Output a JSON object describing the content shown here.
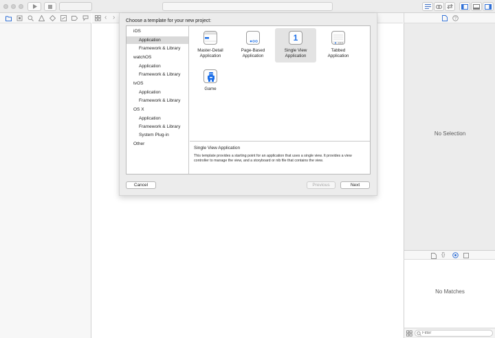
{
  "dialog": {
    "title": "Choose a template for your new project:",
    "categories": [
      {
        "label": "iOS",
        "items": [
          "Application",
          "Framework & Library"
        ]
      },
      {
        "label": "watchOS",
        "items": [
          "Application",
          "Framework & Library"
        ]
      },
      {
        "label": "tvOS",
        "items": [
          "Application",
          "Framework & Library"
        ]
      },
      {
        "label": "OS X",
        "items": [
          "Application",
          "Framework & Library",
          "System Plug-in"
        ]
      },
      {
        "label": "Other",
        "items": []
      }
    ],
    "selected_category": "iOS / Application",
    "templates": [
      {
        "label": "Master-Detail\nApplication",
        "icon": "master-detail-icon"
      },
      {
        "label": "Page-Based\nApplication",
        "icon": "page-based-icon"
      },
      {
        "label": "Single View\nApplication",
        "icon": "single-view-icon",
        "glyph": "1"
      },
      {
        "label": "Tabbed\nApplication",
        "icon": "tabbed-icon"
      },
      {
        "label": "Game",
        "icon": "game-icon"
      }
    ],
    "selected_template": "Single View Application",
    "description": {
      "title": "Single View Application",
      "text": "This template provides a starting point for an application that uses a single view. It provides a view controller to manage the view, and a storyboard or nib file that contains the view."
    },
    "buttons": {
      "cancel": "Cancel",
      "previous": "Previous",
      "next": "Next"
    }
  },
  "inspector": {
    "no_selection": "No Selection"
  },
  "library": {
    "no_matches": "No Matches",
    "filter_placeholder": "Filter"
  },
  "colors": {
    "accent": "#1a6ee8",
    "selection": "#d9d9d9"
  }
}
